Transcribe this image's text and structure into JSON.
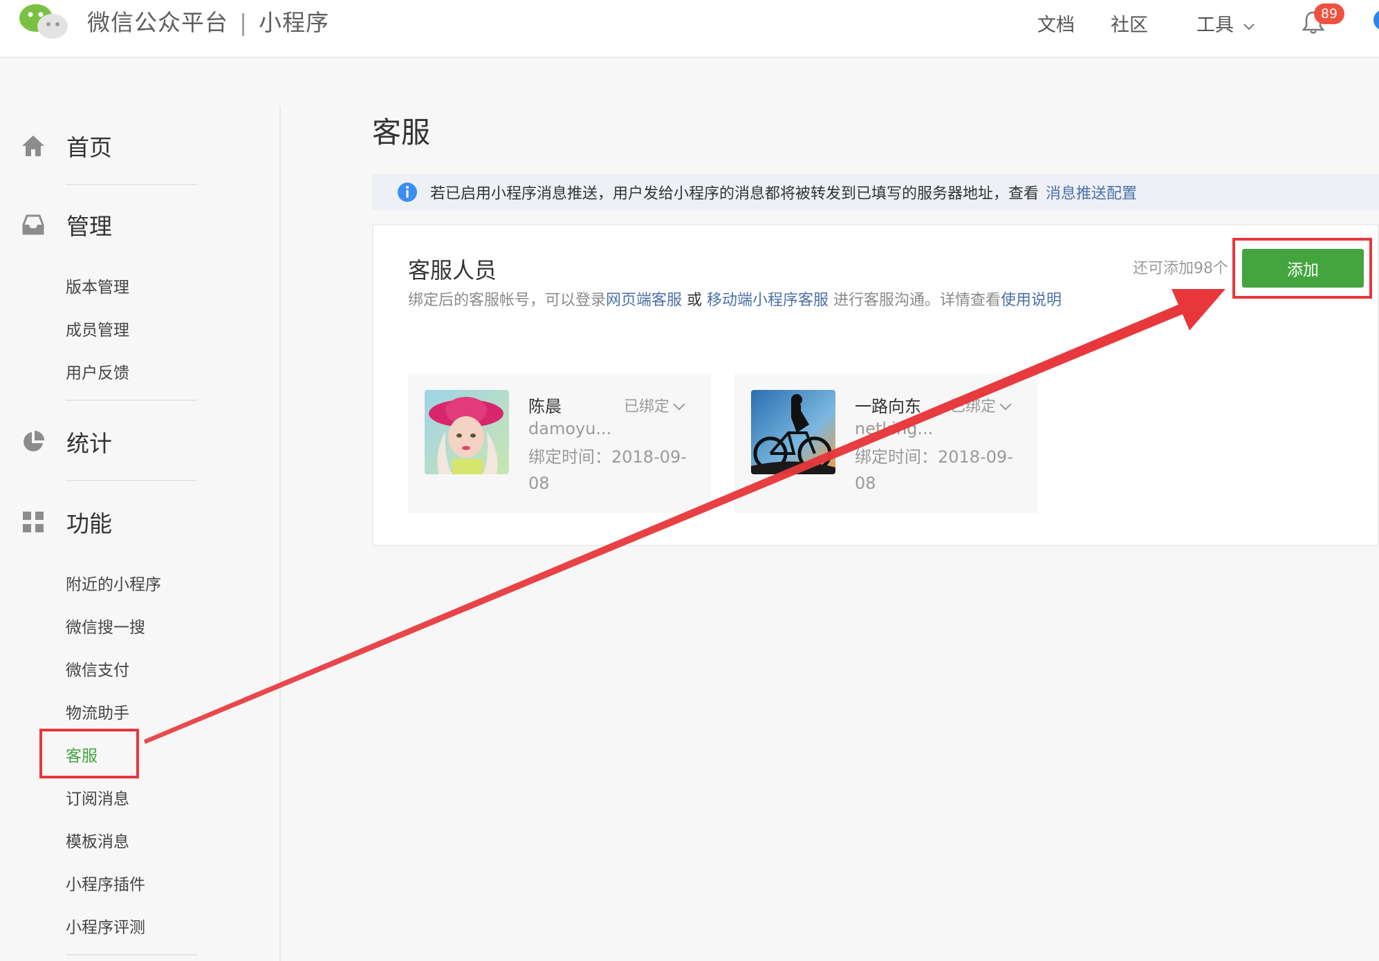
{
  "header": {
    "brand": "微信公众平台",
    "separator": "|",
    "product": "小程序",
    "nav": [
      "文档",
      "社区",
      "工具"
    ],
    "notification_count": "89"
  },
  "sidebar": {
    "groups": [
      {
        "label": "首页",
        "icon": "home-icon",
        "items": []
      },
      {
        "label": "管理",
        "icon": "inbox-icon",
        "items": [
          "版本管理",
          "成员管理",
          "用户反馈"
        ]
      },
      {
        "label": "统计",
        "icon": "pie-chart-icon",
        "items": []
      },
      {
        "label": "功能",
        "icon": "grid-icon",
        "items": [
          "附近的小程序",
          "微信搜一搜",
          "微信支付",
          "物流助手",
          "客服",
          "订阅消息",
          "模板消息",
          "小程序插件",
          "小程序评测"
        ]
      }
    ],
    "active_item": "客服"
  },
  "main": {
    "title": "客服",
    "notice": {
      "text": "若已启用小程序消息推送，用户发给小程序的消息都将被转发到已填写的服务器地址，查看",
      "link": "消息推送配置"
    },
    "panel": {
      "title": "客服人员",
      "desc_part1": "绑定后的客服帐号，可以登录",
      "desc_link1": "网页端客服",
      "desc_or": " 或 ",
      "desc_link2": "移动端小程序客服",
      "desc_part2": " 进行客服沟通。详情查看",
      "desc_link3": "使用说明",
      "remaining": "还可添加98个",
      "add_label": "添加"
    },
    "staff": [
      {
        "name": "陈晨",
        "status": "已绑定",
        "account": "damoyu...",
        "bind_time": "绑定时间：2018-09-08"
      },
      {
        "name": "一路向东",
        "status": "已绑定",
        "account": "netking...",
        "bind_time": "绑定时间：2018-09-08"
      }
    ]
  },
  "colors": {
    "accent_green": "#44a53e",
    "link_blue": "#4b6fa8",
    "annotation_red": "#e7373b"
  }
}
